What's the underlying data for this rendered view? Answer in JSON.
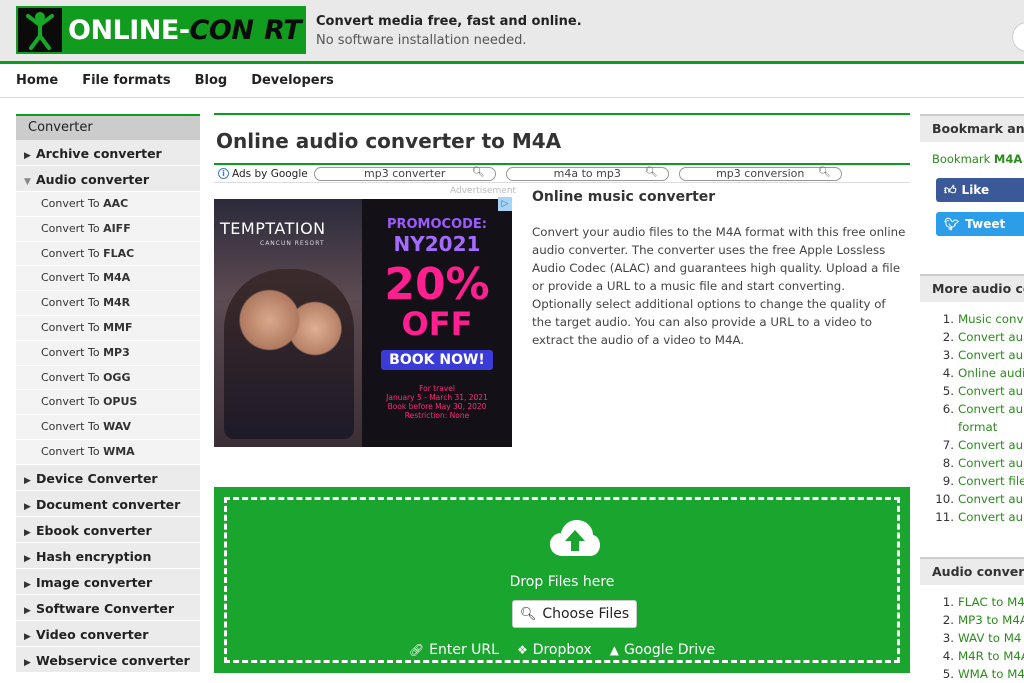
{
  "header": {
    "logo_main": "ONLINE-",
    "logo_con": "CON",
    "logo_rest": "RT",
    "tagline_1": "Convert media free, fast and online.",
    "tagline_2": "No software installation needed."
  },
  "nav": [
    "Home",
    "File formats",
    "Blog",
    "Developers"
  ],
  "sidebar": {
    "head": "Converter",
    "categories_before": [
      "Archive converter"
    ],
    "open_category": "Audio converter",
    "sub_items": [
      {
        "prefix": "Convert To ",
        "fmt": "AAC"
      },
      {
        "prefix": "Convert To ",
        "fmt": "AIFF"
      },
      {
        "prefix": "Convert To ",
        "fmt": "FLAC"
      },
      {
        "prefix": "Convert To ",
        "fmt": "M4A"
      },
      {
        "prefix": "Convert To ",
        "fmt": "M4R"
      },
      {
        "prefix": "Convert To ",
        "fmt": "MMF"
      },
      {
        "prefix": "Convert To ",
        "fmt": "MP3"
      },
      {
        "prefix": "Convert To ",
        "fmt": "OGG"
      },
      {
        "prefix": "Convert To ",
        "fmt": "OPUS"
      },
      {
        "prefix": "Convert To ",
        "fmt": "WAV"
      },
      {
        "prefix": "Convert To ",
        "fmt": "WMA"
      }
    ],
    "categories_after": [
      "Device Converter",
      "Document converter",
      "Ebook converter",
      "Hash encryption",
      "Image converter",
      "Software Converter",
      "Video converter",
      "Webservice converter"
    ]
  },
  "main": {
    "title": "Online audio converter to M4A",
    "ads_label": "Ads by Google",
    "ad_pills": [
      "mp3 converter",
      "m4a to mp3",
      "mp3 conversion"
    ],
    "advertisement_label": "Advertisement",
    "ad": {
      "brand": "TEMPTATION",
      "brand_sub": "CANCUN RESORT",
      "promo": "PROMOCODE:",
      "code": "NY2021",
      "pct": "20%",
      "off": "OFF",
      "book": "BOOK NOW!",
      "fine_1": "For travel",
      "fine_2": "January 5 - March 31, 2021",
      "fine_3": "Book before May 30, 2020",
      "fine_4": "Restriction: None"
    },
    "intro_title": "Online music converter",
    "intro_text": "Convert your audio files to the M4A format with this free online audio converter. The converter uses the free Apple Lossless Audio Codec (ALAC) and guarantees high quality. Upload a file or provide a URL to a music file and start converting. Optionally select additional options to change the quality of the target audio. You can also provide a URL to a video to extract the audio of a video to M4A.",
    "drop_text": "Drop Files here",
    "choose_label": "Choose Files",
    "links": [
      "Enter URL",
      "Dropbox",
      "Google Drive"
    ]
  },
  "right": {
    "bookmark_head": "Bookmark and",
    "bookmark_text": "Bookmark ",
    "bookmark_bold": "M4A",
    "like": "Like",
    "tweet": "Tweet",
    "more_head": "More audio co",
    "more_items": [
      "Music conv",
      "Convert au",
      "Convert au",
      "Online audi",
      "Convert au",
      "Convert au format",
      "Convert au",
      "Convert au",
      "Convert file",
      "Convert au",
      "Convert au"
    ],
    "audio_head": "Audio convert",
    "audio_items": [
      "FLAC to M4",
      "MP3 to M4A",
      "WAV to M4",
      "M4R to M4A",
      "WMA to M4"
    ]
  },
  "colors": {
    "brand_green": "#0c9d1e",
    "dropzone_green": "#1aa52f",
    "link_green": "#2a8c1b",
    "facebook_blue": "#3b5998",
    "twitter_blue": "#2b9de9"
  }
}
